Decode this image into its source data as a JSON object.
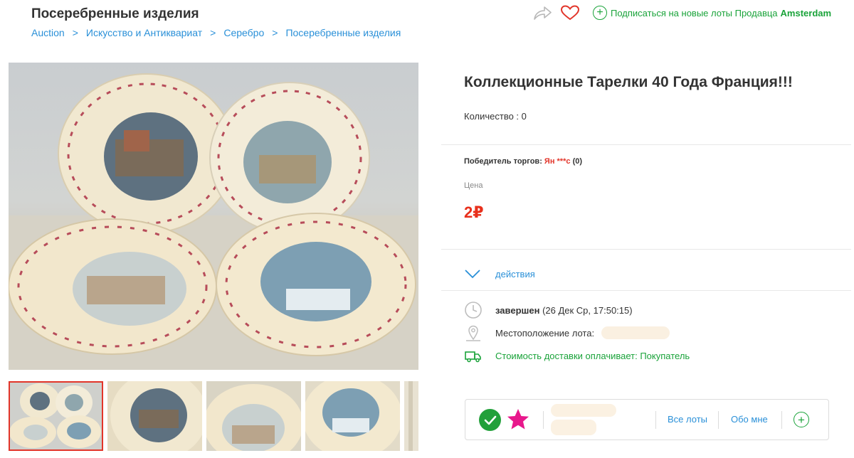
{
  "header": {
    "page_title": "Посеребренные изделия",
    "breadcrumbs": [
      "Auction",
      "Искусство и Антиквариат",
      "Серебро",
      "Посеребренные изделия"
    ],
    "breadcrumb_separator": ">",
    "subscribe_text": "Подписаться на новые лоты Продавца",
    "seller_name": "Amsterdam",
    "subscribe_plus": "+"
  },
  "lot": {
    "title": "Коллекционные Тарелки 40 Года Франция!!!",
    "quantity": "Количество : 0",
    "winner_label": "Победитель торгов:",
    "winner_name": "Ян ***с",
    "winner_count": "(0)",
    "price_label": "Цена",
    "price": "2₽",
    "actions_label": "действия"
  },
  "info": {
    "status_bold": "завершен",
    "status_detail": "(26 Дек Ср, 17:50:15)",
    "location_label": "Местоположение лота:",
    "shipping": "Стоимость доставки оплачивает: Покупатель"
  },
  "seller_card": {
    "all_lots": "Все лоты",
    "about_me": "Обо мне",
    "plus": "+"
  },
  "icons": [
    "share-icon",
    "heart-icon",
    "plus-circle-icon",
    "chevron-down-icon",
    "clock-icon",
    "location-pin-icon",
    "truck-icon",
    "check-icon",
    "star-icon"
  ],
  "colors": {
    "link": "#2a90d8",
    "accent_green": "#1aa33a",
    "price_red": "#e8301c",
    "heart_red": "#e2352a",
    "star_pink": "#e8188c"
  }
}
